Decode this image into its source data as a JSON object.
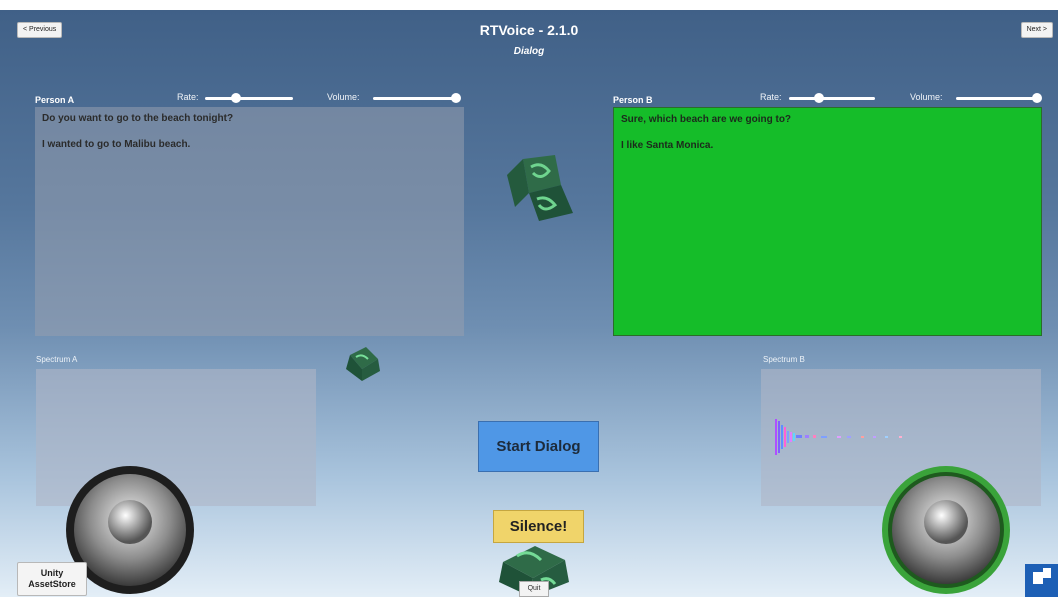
{
  "app": {
    "title": "RTVoice - 2.1.0",
    "subtitle": "Dialog"
  },
  "nav": {
    "previous_label": "< Previous",
    "next_label": "Next >"
  },
  "person_a": {
    "label": "Person A",
    "rate_label": "Rate:",
    "volume_label": "Volume:",
    "rate_value": 0.35,
    "volume_value": 1.0,
    "lines": [
      "Do you want to go to the beach tonight?",
      "I wanted to go to Malibu beach."
    ],
    "spectrum_label": "Spectrum A"
  },
  "person_b": {
    "label": "Person B",
    "rate_label": "Rate:",
    "volume_label": "Volume:",
    "rate_value": 0.35,
    "volume_value": 1.0,
    "lines": [
      "Sure, which beach are we going to?",
      "I like Santa Monica."
    ],
    "spectrum_label": "Spectrum B",
    "active_color": "#15bd29"
  },
  "buttons": {
    "start_dialog": "Start Dialog",
    "silence": "Silence!",
    "quit": "Quit",
    "asset_store_line1": "Unity",
    "asset_store_line2": "AssetStore"
  },
  "colors": {
    "start_button": "#4f97e6",
    "silence_button": "#f0d46a",
    "speaker_ring_active": "#3aa33a"
  }
}
